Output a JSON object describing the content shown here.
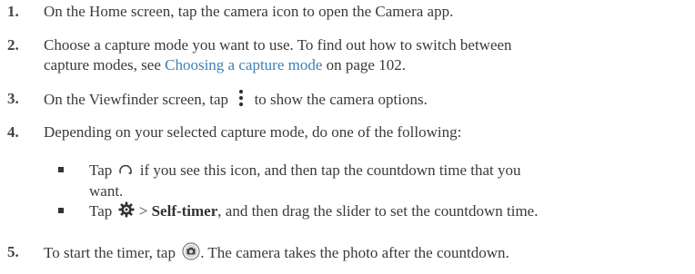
{
  "steps": [
    {
      "num": "1.",
      "text": "On the Home screen, tap the camera icon to open the Camera app."
    },
    {
      "num": "2.",
      "line1": "Choose a capture mode you want to use. To find out how to switch between",
      "line2_prefix": "capture modes, see ",
      "link": "Choosing a capture mode",
      "line2_suffix": " on page 102."
    },
    {
      "num": "3.",
      "prefix": "On the Viewfinder screen, tap",
      "suffix": "to show the camera options.",
      "icon": "more-options-vertical-dots-icon"
    },
    {
      "num": "4.",
      "text": "Depending on your selected capture mode, do one of the following:"
    },
    {
      "num": "5.",
      "prefix": "To start the timer, tap",
      "suffix": ". The camera takes the photo after the countdown.",
      "icon": "shutter-button-icon"
    }
  ],
  "subitems": [
    {
      "prefix": "Tap",
      "line1_suffix": "if you see this icon, and then tap the countdown time that you",
      "line2": "want.",
      "icon": "timer-arc-icon"
    },
    {
      "prefix": "Tap",
      "mid": " > ",
      "bold": "Self-timer",
      "suffix": ", and then drag the slider to set the countdown time.",
      "icon": "gear-settings-icon"
    }
  ]
}
